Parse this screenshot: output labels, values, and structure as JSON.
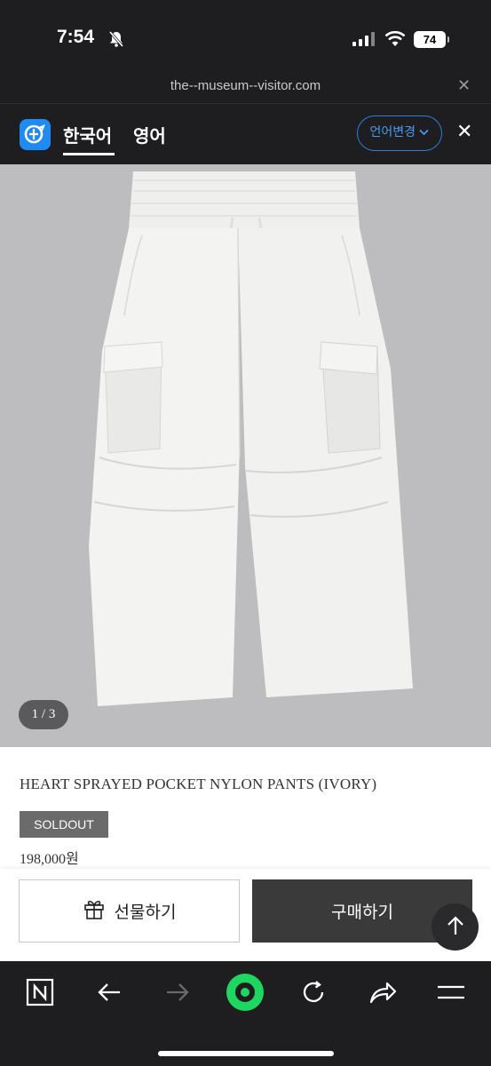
{
  "status": {
    "time": "7:54",
    "battery": "74"
  },
  "browser": {
    "url": "the--museum--visitor.com"
  },
  "translate": {
    "tab_korean": "한국어",
    "tab_english": "영어",
    "change_language": "언어변경"
  },
  "product": {
    "image_counter": "1 / 3",
    "title": "HEART SPRAYED POCKET NYLON PANTS (IVORY)",
    "status_badge": "SOLDOUT",
    "price": "198,000원"
  },
  "actions": {
    "gift_label": "선물하기",
    "buy_label": "구매하기"
  },
  "colors": {
    "accent_blue": "#1f8bf0",
    "nav_green": "#1ed760",
    "buy_dark": "#3a3a3a",
    "badge_gray": "#6b6b6b"
  }
}
